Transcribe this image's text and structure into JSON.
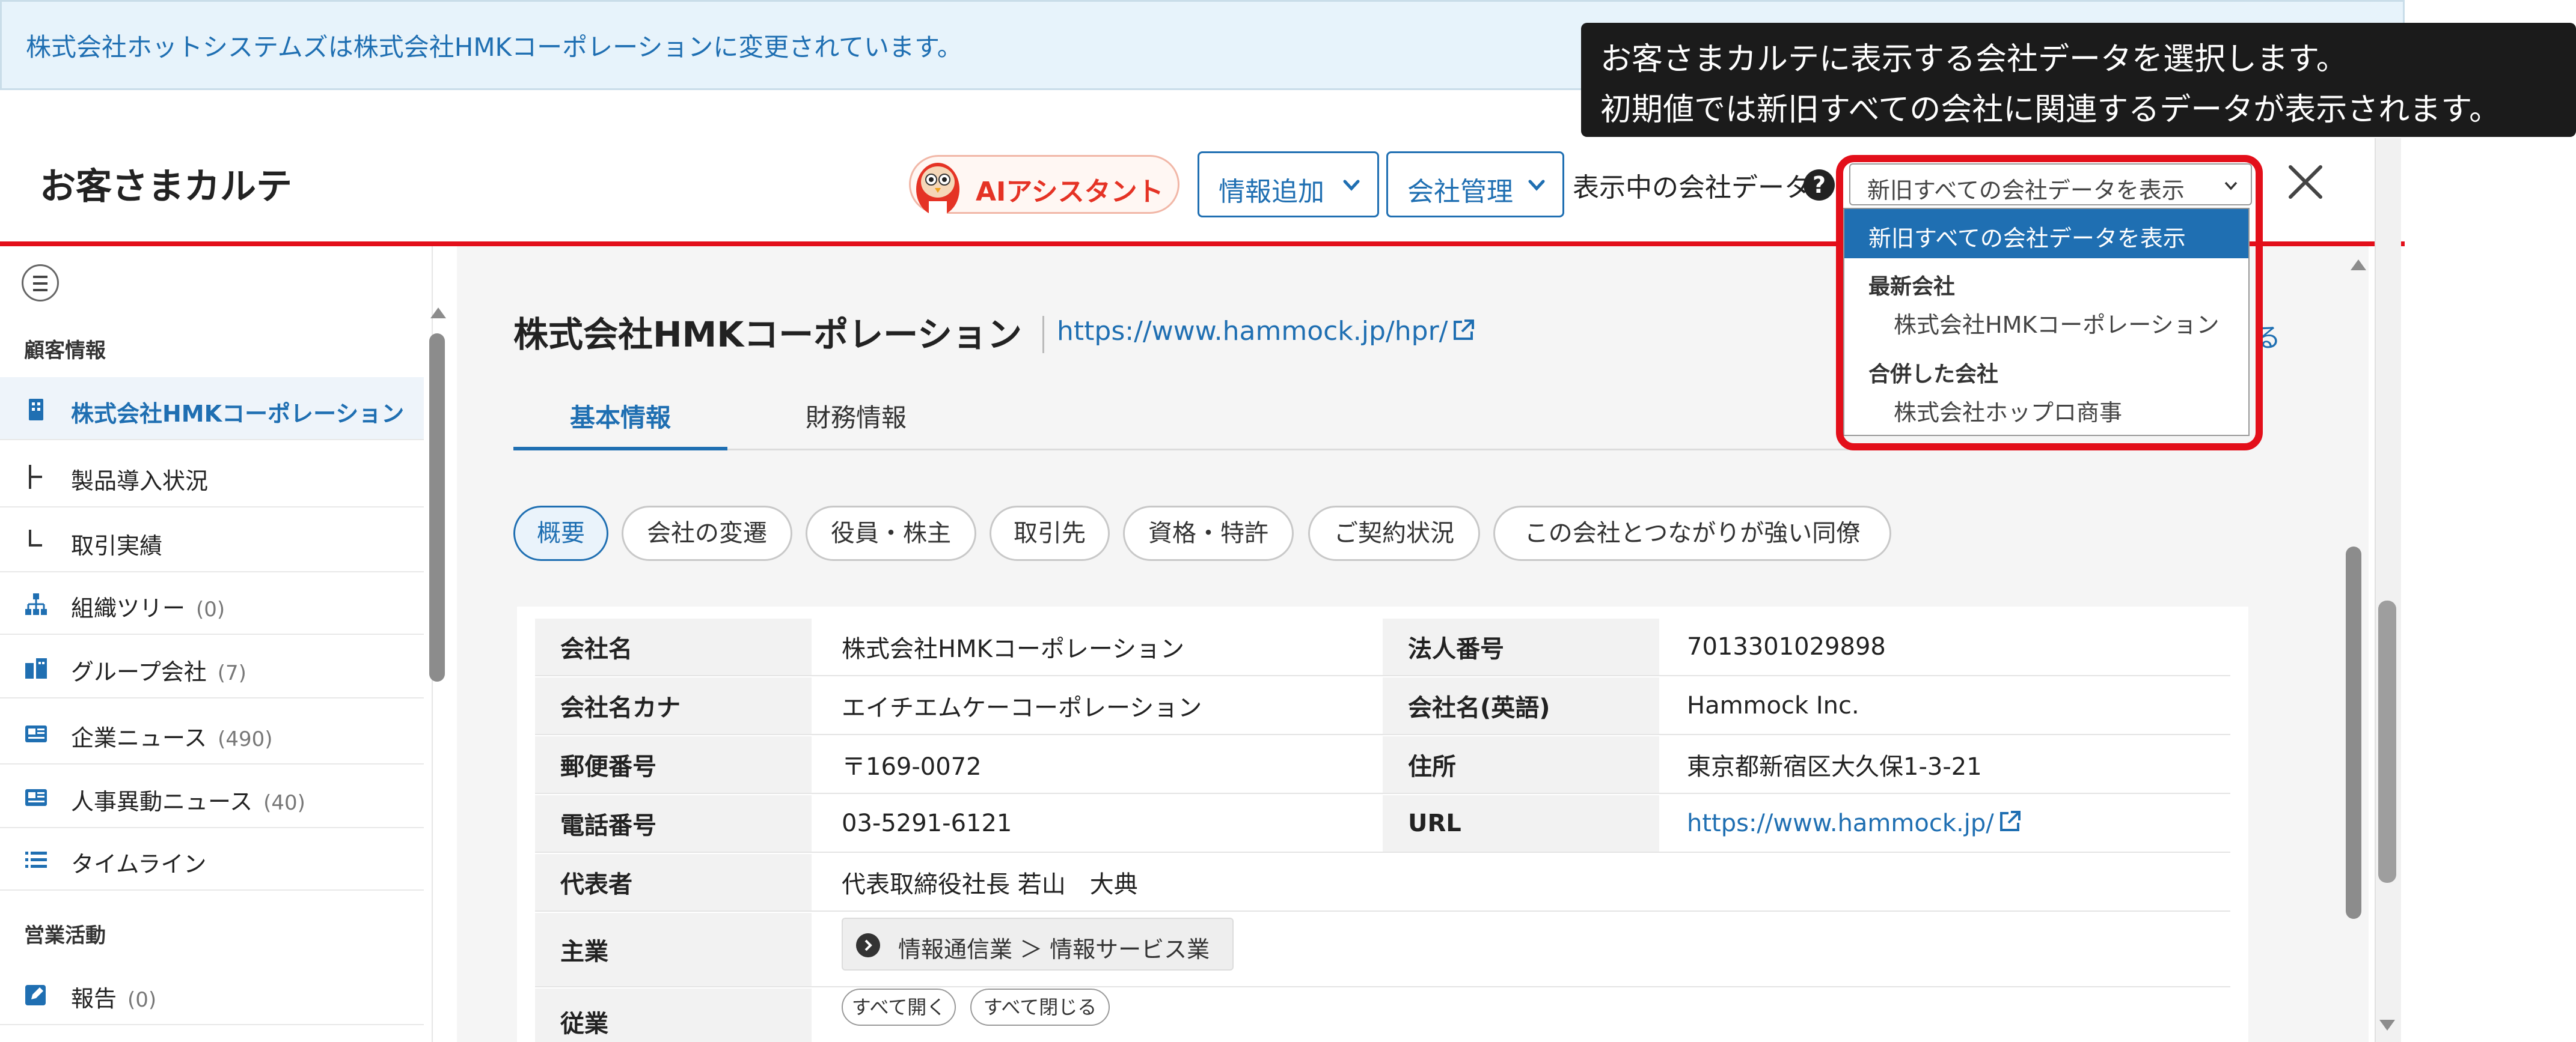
{
  "notice": {
    "text": "株式会社ホットシステムズは株式会社HMKコーポレーションに変更されています。"
  },
  "header": {
    "title": "お客さまカルテ",
    "ai_assistant_label": "AIアシスタント",
    "info_add_label": "情報追加",
    "company_manage_label": "会社管理",
    "shown_data_label": "表示中の会社データ",
    "help_icon": "question-circle-icon",
    "company_select_value": "新旧すべての会社データを表示",
    "close_icon": "close-icon"
  },
  "tooltip": {
    "line1": "お客さまカルテに表示する会社データを選択します。",
    "line2": "初期値では新旧すべての会社に関連するデータが表示されます。"
  },
  "dropdown": {
    "selected": "新旧すべての会社データを表示",
    "group_latest": "最新会社",
    "latest_option": "株式会社HMKコーポレーション",
    "group_merged": "合併した会社",
    "merged_option": "株式会社ホップロ商事"
  },
  "sidebar": {
    "section_customer": "顧客情報",
    "section_sales": "営業活動",
    "items": [
      {
        "label": "株式会社HMKコーポレーション",
        "count": "",
        "icon": "building-icon"
      },
      {
        "label": "製品導入状況",
        "count": "",
        "icon": "tree-branch-icon"
      },
      {
        "label": "取引実績",
        "count": "",
        "icon": "tree-end-icon"
      },
      {
        "label": "組織ツリー",
        "count": "(0)",
        "icon": "org-tree-icon"
      },
      {
        "label": "グループ会社",
        "count": "(7)",
        "icon": "group-company-icon"
      },
      {
        "label": "企業ニュース",
        "count": "(490)",
        "icon": "news-icon"
      },
      {
        "label": "人事異動ニュース",
        "count": "(40)",
        "icon": "news-icon"
      },
      {
        "label": "タイムライン",
        "count": "",
        "icon": "list-icon"
      },
      {
        "label": "報告",
        "count": "(0)",
        "icon": "edit-report-icon"
      }
    ]
  },
  "main": {
    "company_name": "株式会社HMKコーポレーション",
    "company_url": "https://www.hammock.jp/hpr/",
    "right_glyph": "る",
    "tabs": [
      "基本情報",
      "財務情報"
    ],
    "pills": [
      "概要",
      "会社の変遷",
      "役員・株主",
      "取引先",
      "資格・特許",
      "ご契約状況",
      "この会社とつながりが強い同僚"
    ],
    "table": {
      "rows": [
        {
          "h1": "会社名",
          "v1": "株式会社HMKコーポレーション",
          "h2": "法人番号",
          "v2": "7013301029898"
        },
        {
          "h1": "会社名カナ",
          "v1": "エイチエムケーコーポレーション",
          "h2": "会社名(英語)",
          "v2": "Hammock Inc."
        },
        {
          "h1": "郵便番号",
          "v1": "〒169-0072",
          "h2": "住所",
          "v2": "東京都新宿区大久保1-3-21"
        },
        {
          "h1": "電話番号",
          "v1": "03-5291-6121",
          "h2": "URL",
          "v2": "https://www.hammock.jp/"
        },
        {
          "h1": "代表者",
          "v1": "代表取締役社長 若山　大典"
        },
        {
          "h1": "主業",
          "v1": "情報通信業 ＞ 情報サービス業"
        },
        {
          "h1": "従業"
        }
      ],
      "expand_all": "すべて開く",
      "collapse_all": "すべて閉じる"
    }
  },
  "colors": {
    "accent_blue": "#1f6fb2",
    "brand_red": "#e30f1a",
    "notice_bg": "#e7f3fb"
  }
}
